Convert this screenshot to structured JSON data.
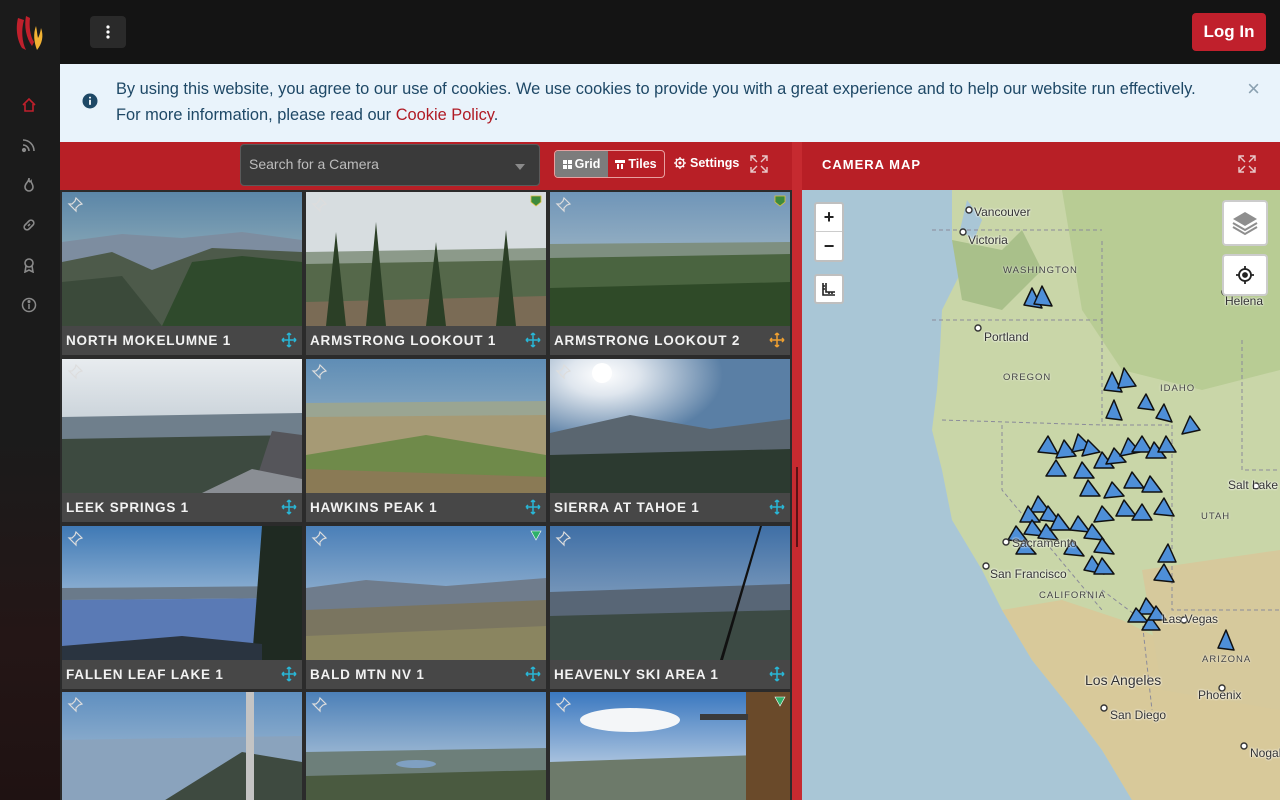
{
  "topbar": {
    "login_label": "Log In"
  },
  "sidebar": {
    "items": [
      {
        "icon": "home-icon",
        "active": true
      },
      {
        "icon": "rss-feed-icon",
        "active": false
      },
      {
        "icon": "fire-icon",
        "active": false
      },
      {
        "icon": "link-icon",
        "active": false
      },
      {
        "icon": "award-icon",
        "active": false
      },
      {
        "icon": "info-icon",
        "active": false
      }
    ]
  },
  "cookie": {
    "text": "By using this website, you agree to our use of cookies. We use cookies to provide you with a great experience and to help our website run effectively. For more information, please read our ",
    "link_label": "Cookie Policy",
    "period": ".",
    "close_label": "×"
  },
  "cameras": {
    "search_placeholder": "Search for a Camera",
    "view_grid_label": "Grid",
    "view_tiles_label": "Tiles",
    "settings_label": "Settings",
    "tiles": [
      {
        "name": "NORTH MOKELUMNE 1",
        "badge": "none",
        "move_color": "#29b6d6"
      },
      {
        "name": "ARMSTRONG LOOKOUT 1",
        "badge": "usfs-shield",
        "move_color": "#29b6d6"
      },
      {
        "name": "ARMSTRONG LOOKOUT 2",
        "badge": "usfs-shield",
        "move_color": "#f0a030"
      },
      {
        "name": "LEEK SPRINGS 1",
        "badge": "none",
        "move_color": "#29b6d6"
      },
      {
        "name": "HAWKINS PEAK 1",
        "badge": "none",
        "move_color": "#29b6d6"
      },
      {
        "name": "SIERRA AT TAHOE 1",
        "badge": "none",
        "move_color": "#29b6d6"
      },
      {
        "name": "FALLEN LEAF LAKE 1",
        "badge": "none",
        "move_color": "#29b6d6"
      },
      {
        "name": "BALD MTN NV 1",
        "badge": "green-triangle",
        "move_color": "#29b6d6"
      },
      {
        "name": "HEAVENLY SKI AREA 1",
        "badge": "none",
        "move_color": "#29b6d6"
      },
      {
        "name": "",
        "badge": "none",
        "move_color": "#29b6d6"
      },
      {
        "name": "",
        "badge": "none",
        "move_color": "#29b6d6"
      },
      {
        "name": "",
        "badge": "green-triangle",
        "move_color": "#29b6d6"
      }
    ]
  },
  "map": {
    "title": "CAMERA MAP",
    "zoom_in": "+",
    "zoom_out": "−",
    "cities": [
      "Vancouver",
      "Victoria",
      "Helena",
      "Portland",
      "Salt Lake C",
      "San Francisco",
      "Sacramento",
      "Las Vegas",
      "Los Angeles",
      "Phoenix",
      "San Diego",
      "Nogale"
    ],
    "states": [
      "WASHINGTON",
      "OREGON",
      "IDAHO",
      "UTAH",
      "CALIFORNIA",
      "ARIZONA"
    ],
    "colors": {
      "water": "#a9c6d6",
      "land": "#c9d6a8",
      "marker": "#4e8fd8"
    }
  }
}
